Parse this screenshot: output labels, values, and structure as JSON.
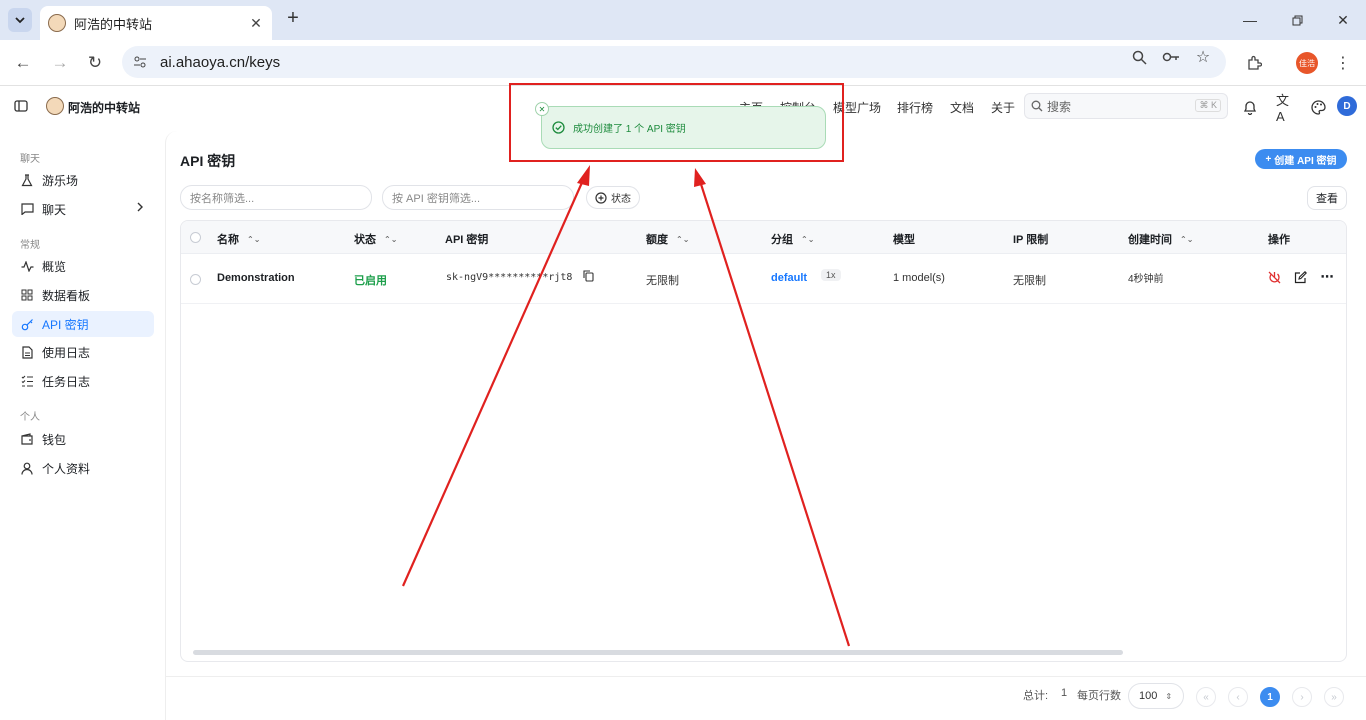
{
  "browser": {
    "tab_title": "阿浩的中转站",
    "url": "ai.ahaoya.cn/keys",
    "profile_label": "佳浩"
  },
  "header": {
    "brand": "阿浩的中转站",
    "nav": [
      "主页",
      "控制台",
      "模型广场",
      "排行榜",
      "文档",
      "关于"
    ],
    "search_placeholder": "搜索",
    "search_shortcut": "⌘ K",
    "avatar_letter": "D"
  },
  "sidebar": {
    "sections": {
      "chat": "聊天",
      "general": "常规",
      "personal": "个人"
    },
    "items": {
      "playground": "游乐场",
      "chat": "聊天",
      "overview": "概览",
      "dashboard": "数据看板",
      "api_keys": "API 密钥",
      "usage_logs": "使用日志",
      "task_logs": "任务日志",
      "wallet": "钱包",
      "profile": "个人资料"
    }
  },
  "page": {
    "title": "API 密钥",
    "create_button": "创建 API 密钥",
    "filter_name_placeholder": "按名称筛选...",
    "filter_key_placeholder": "按 API 密钥筛选...",
    "status_filter": "状态",
    "view_button": "查看"
  },
  "table": {
    "headers": {
      "name": "名称",
      "status": "状态",
      "api_key": "API 密钥",
      "quota": "额度",
      "group": "分组",
      "model": "模型",
      "ip_limit": "IP 限制",
      "created": "创建时间",
      "actions": "操作"
    },
    "rows": [
      {
        "name": "Demonstration",
        "status": "已启用",
        "api_key": "sk-ngV9**********rjt8",
        "quota": "无限制",
        "group": "default",
        "ratio": "1x",
        "model": "1 model(s)",
        "ip_limit": "无限制",
        "created": "4秒钟前"
      }
    ]
  },
  "pagination": {
    "total_label": "总计:",
    "total": "1",
    "rows_per_page_label": "每页行数",
    "page_size": "100",
    "current_page": "1"
  },
  "toast": {
    "message": "成功创建了 1 个 API 密钥"
  },
  "colors": {
    "accent": "#3c8cf0",
    "success": "#1d9f4b",
    "annotation": "#e0211f"
  }
}
